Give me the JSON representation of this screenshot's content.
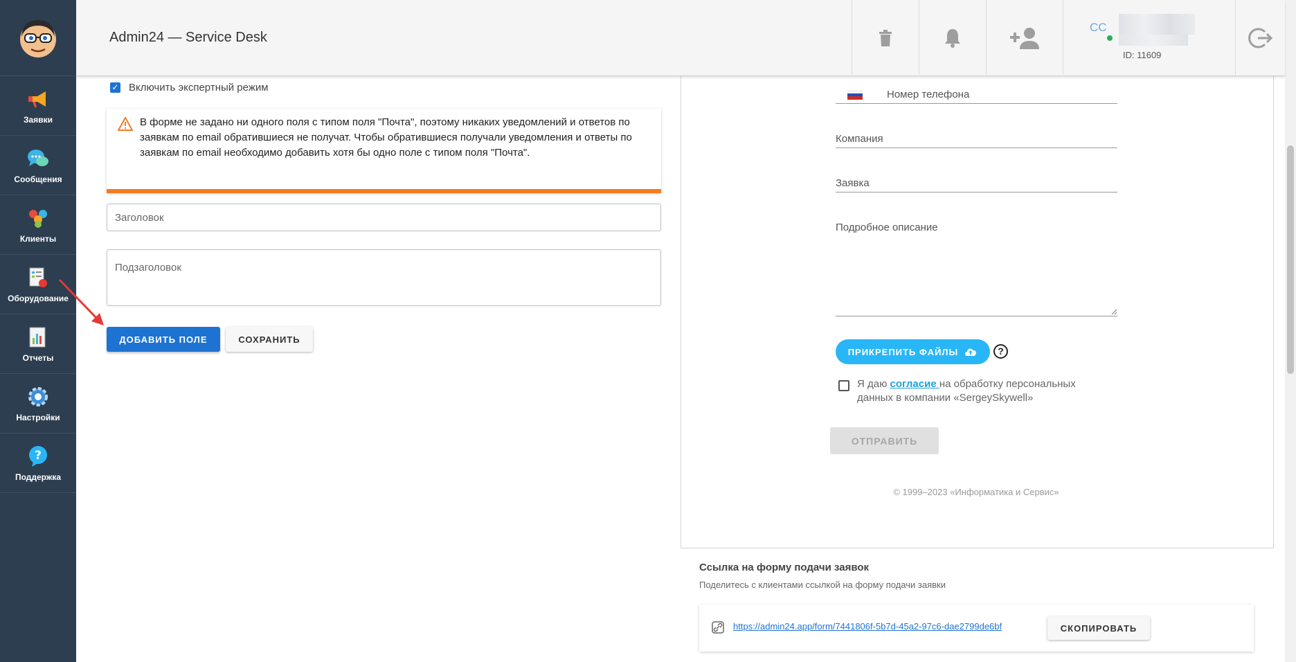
{
  "app": {
    "title": "Admin24 — Service Desk"
  },
  "sidebar": {
    "items": [
      {
        "label": "Заявки",
        "icon": "megaphone-icon"
      },
      {
        "label": "Сообщения",
        "icon": "chat-bubbles-icon"
      },
      {
        "label": "Клиенты",
        "icon": "people-icon"
      },
      {
        "label": "Оборудование",
        "icon": "equipment-icon"
      },
      {
        "label": "Отчеты",
        "icon": "report-icon"
      },
      {
        "label": "Настройки",
        "icon": "gear-icon"
      },
      {
        "label": "Поддержка",
        "icon": "help-bubble-icon"
      }
    ]
  },
  "header": {
    "user_initials": "CC",
    "user_id": "ID: 11609"
  },
  "editor": {
    "expert_mode_label": "Включить экспертный режим",
    "warning_text": "В форме не задано ни одного поля с типом поля \"Почта\", поэтому никаких уведомлений и ответов по заявкам по email обратившиеся не получат. Чтобы обратившиеся получали уведомления и ответы по заявкам по email необходимо добавить хотя бы одно поле с типом поля \"Почта\".",
    "title_placeholder": "Заголовок",
    "subtitle_placeholder": "Подзаголовок",
    "add_field_label": "ДОБАВИТЬ ПОЛЕ",
    "save_label": "СОХРАНИТЬ"
  },
  "preview": {
    "phone_label": "Номер телефона",
    "company_label": "Компания",
    "request_label": "Заявка",
    "description_label": "Подробное описание",
    "attach_label": "ПРИКРЕПИТЬ ФАЙЛЫ",
    "help_symbol": "?",
    "consent_before": "Я даю ",
    "consent_link": "согласие ",
    "consent_after": "на обработку персональных данных в компании «SergeySkywell»",
    "send_label": "ОТПРАВИТЬ",
    "copyright": "© 1999–2023 «Информатика и Сервис»"
  },
  "link_section": {
    "heading": "Ссылка на форму подачи заявок",
    "subtitle": "Поделитесь с клиентами ссылкой на форму подачи заявки",
    "url": "https://admin24.app/form/7441806f-5b7d-45a2-97c6-dae2799de6bf",
    "copy_label": "СКОПИРОВАТЬ"
  },
  "colors": {
    "sidebar_bg": "#2c3e50",
    "primary": "#1e73d2",
    "warning_accent": "#f47b20",
    "attach_button": "#29b6f6"
  }
}
